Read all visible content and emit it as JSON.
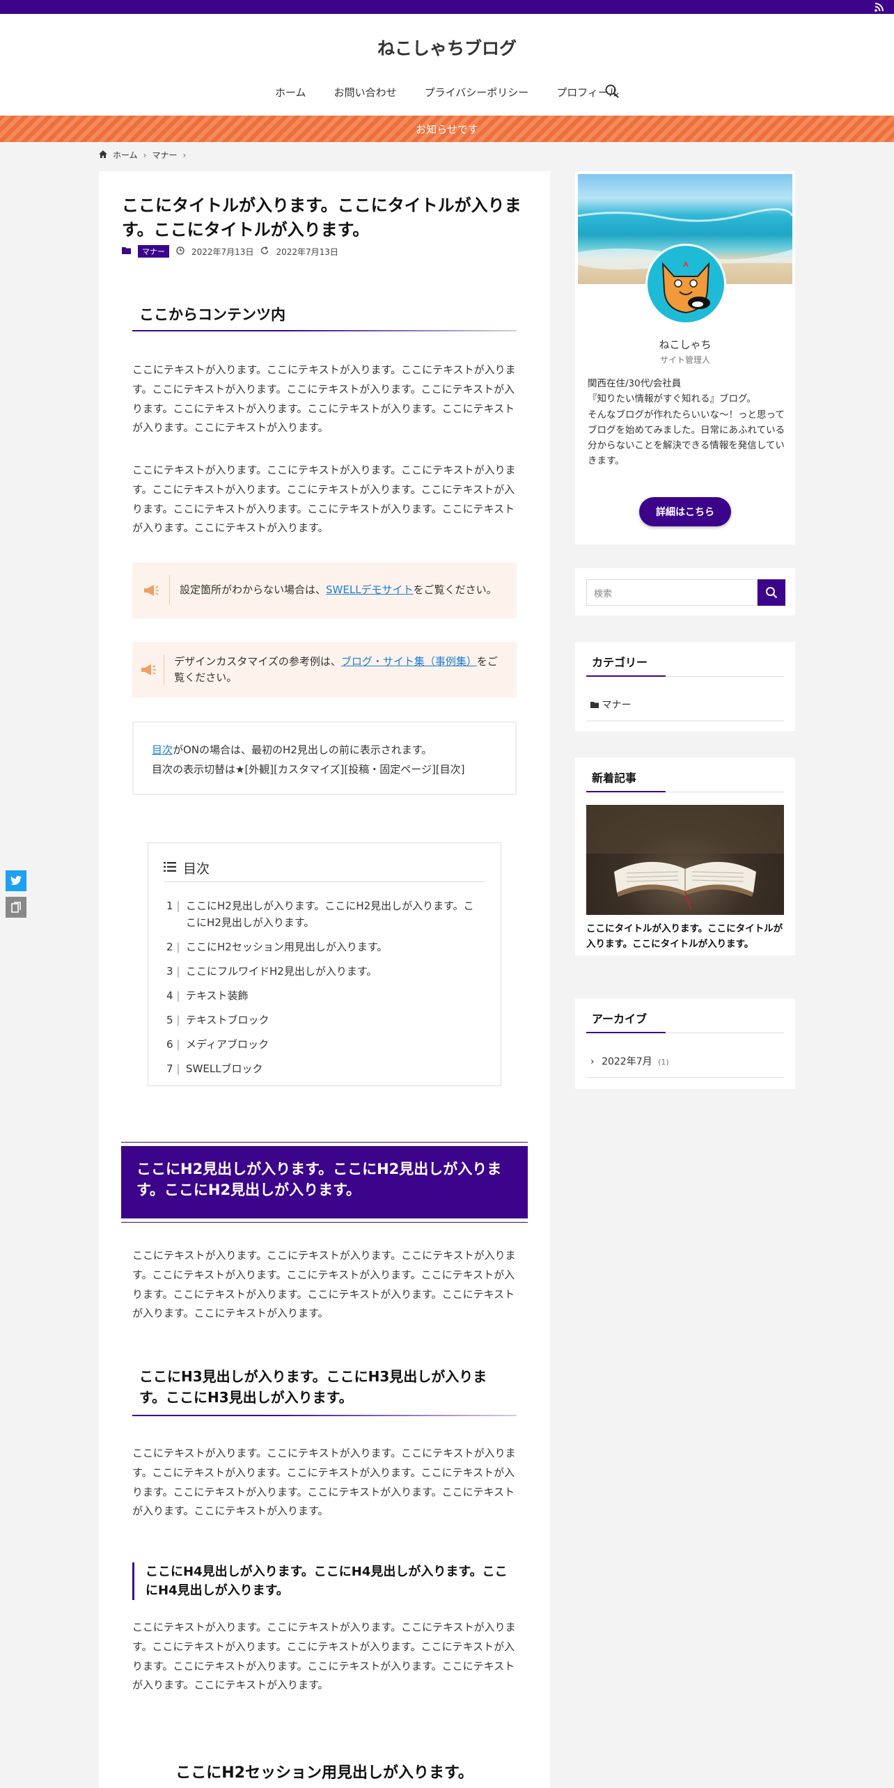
{
  "site": {
    "title": "ねこしゃちブログ"
  },
  "nav": {
    "items": [
      "ホーム",
      "お問い合わせ",
      "プライバシーポリシー",
      "プロフィール"
    ]
  },
  "notice": {
    "text": "お知らせです"
  },
  "breadcrumb": {
    "home": "ホーム",
    "category": "マナー"
  },
  "post": {
    "title": "ここにタイトルが入ります。ここにタイトルが入ります。ここにタイトルが入ります。",
    "category": "マナー",
    "published": "2022年7月13日",
    "updated": "2022年7月13日"
  },
  "content": {
    "h2_first": "ここからコンテンツ内",
    "paragraph": "ここにテキストが入ります。ここにテキストが入ります。ここにテキストが入ります。ここにテキストが入ります。ここにテキストが入ります。ここにテキストが入ります。ここにテキストが入ります。ここにテキストが入ります。ここにテキストが入ります。ここにテキストが入ります。",
    "cap1_pre": "設定箇所がわからない場合は、",
    "cap1_link": "SWELLデモサイト",
    "cap1_post": "をご覧ください。",
    "cap2_pre": "デザインカスタマイズの参考例は、",
    "cap2_link": "ブログ・サイト集（事例集）",
    "cap2_post": "をご覧ください。",
    "box_link": "目次",
    "box_line1_post": "がONの場合は、最初のH2見出しの前に表示されます。",
    "box_line2": "目次の表示切替は★[外観][カスタマイズ][投稿・固定ページ][目次]",
    "h2_band": "ここにH2見出しが入ります。ここにH2見出しが入ります。ここにH2見出しが入ります。",
    "h3": "ここにH3見出しが入ります。ここにH3見出しが入ります。ここにH3見出しが入ります。",
    "h4": "ここにH4見出しが入ります。ここにH4見出しが入ります。ここにH4見出しが入ります。",
    "h2_session": "ここにH2セッション用見出しが入ります。"
  },
  "toc": {
    "title": "目次",
    "items": [
      {
        "num": "1",
        "text": "ここにH2見出しが入ります。ここにH2見出しが入ります。ここにH2見出しが入ります。"
      },
      {
        "num": "2",
        "text": "ここにH2セッション用見出しが入ります。"
      },
      {
        "num": "3",
        "text": "ここにフルワイドH2見出しが入ります。"
      },
      {
        "num": "4",
        "text": "テキスト装飾"
      },
      {
        "num": "5",
        "text": "テキストブロック"
      },
      {
        "num": "6",
        "text": "メディアブロック"
      },
      {
        "num": "7",
        "text": "SWELLブロック"
      }
    ]
  },
  "profile": {
    "name": "ねこしゃち",
    "role": "サイト管理人",
    "desc_line1": "関西在住/30代/会社員",
    "desc_line2": "『知りたい情報がすぐ知れる』ブログ。",
    "desc_line3": "そんなブログが作れたらいいな～！っと思ってブログを始めてみました。日常にあふれている分からないことを解決できる情報を発信していきます。",
    "button": "詳細はこちら"
  },
  "search": {
    "placeholder": "検索"
  },
  "widgets": {
    "category_title": "カテゴリー",
    "category_item": "マナー",
    "new_title": "新着記事",
    "new_caption": "ここにタイトルが入ります。ここにタイトルが入ります。ここにタイトルが入ります。",
    "archive_title": "アーカイブ",
    "archive_item": "2022年7月",
    "archive_count": "(1)"
  },
  "colors": {
    "main": "#3b048a",
    "notice": "#ee6f3b",
    "link": "#1d7ed0",
    "twitter": "#1da1f2"
  }
}
